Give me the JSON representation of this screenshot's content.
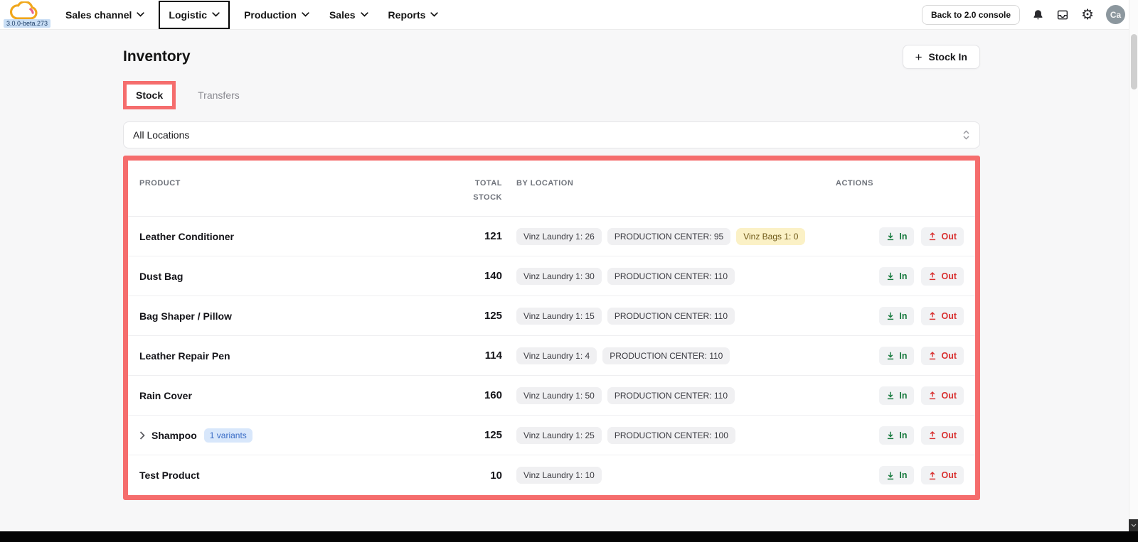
{
  "topbar": {
    "version_badge": "3.0.0-beta.273",
    "nav_items": [
      {
        "label": "Sales channel",
        "boxed": false
      },
      {
        "label": "Logistic",
        "boxed": true
      },
      {
        "label": "Production",
        "boxed": false
      },
      {
        "label": "Sales",
        "boxed": false
      },
      {
        "label": "Reports",
        "boxed": false
      }
    ],
    "back_button": "Back to 2.0 console",
    "avatar_initials": "Ca"
  },
  "page": {
    "title": "Inventory",
    "stock_in_button": "Stock In",
    "tabs": [
      {
        "label": "Stock",
        "active": true,
        "highlighted": true
      },
      {
        "label": "Transfers",
        "active": false,
        "highlighted": false
      }
    ],
    "location_filter": {
      "value": "All Locations"
    }
  },
  "inventory_table": {
    "headers": {
      "product": "PRODUCT",
      "total_stock": "TOTAL STOCK",
      "by_location": "BY LOCATION",
      "actions": "ACTIONS"
    },
    "action_in": "In",
    "action_out": "Out",
    "rows": [
      {
        "product": "Leather Conditioner",
        "total_stock": "121",
        "expandable": false,
        "variants_badge": "",
        "locations": [
          {
            "label": "Vinz Laundry 1: 26",
            "style": "gray"
          },
          {
            "label": "PRODUCTION CENTER: 95",
            "style": "gray"
          },
          {
            "label": "Vinz Bags 1: 0",
            "style": "yellow"
          }
        ]
      },
      {
        "product": "Dust Bag",
        "total_stock": "140",
        "expandable": false,
        "variants_badge": "",
        "locations": [
          {
            "label": "Vinz Laundry 1: 30",
            "style": "gray"
          },
          {
            "label": "PRODUCTION CENTER: 110",
            "style": "gray"
          }
        ]
      },
      {
        "product": "Bag Shaper / Pillow",
        "total_stock": "125",
        "expandable": false,
        "variants_badge": "",
        "locations": [
          {
            "label": "Vinz Laundry 1: 15",
            "style": "gray"
          },
          {
            "label": "PRODUCTION CENTER: 110",
            "style": "gray"
          }
        ]
      },
      {
        "product": "Leather Repair Pen",
        "total_stock": "114",
        "expandable": false,
        "variants_badge": "",
        "locations": [
          {
            "label": "Vinz Laundry 1: 4",
            "style": "gray"
          },
          {
            "label": "PRODUCTION CENTER: 110",
            "style": "gray"
          }
        ]
      },
      {
        "product": "Rain Cover",
        "total_stock": "160",
        "expandable": false,
        "variants_badge": "",
        "locations": [
          {
            "label": "Vinz Laundry 1: 50",
            "style": "gray"
          },
          {
            "label": "PRODUCTION CENTER: 110",
            "style": "gray"
          }
        ]
      },
      {
        "product": "Shampoo",
        "total_stock": "125",
        "expandable": true,
        "variants_badge": "1 variants",
        "locations": [
          {
            "label": "Vinz Laundry 1: 25",
            "style": "gray"
          },
          {
            "label": "PRODUCTION CENTER: 100",
            "style": "gray"
          }
        ]
      },
      {
        "product": "Test Product",
        "total_stock": "10",
        "expandable": false,
        "variants_badge": "",
        "locations": [
          {
            "label": "Vinz Laundry 1: 10",
            "style": "gray"
          }
        ]
      }
    ]
  },
  "colors": {
    "annotation_red": "#f56d6d",
    "in_green": "#187a3e",
    "out_red": "#d93030",
    "yellow_pill_bg": "#fbf1c6",
    "gray_pill_bg": "#f0f0f2",
    "variants_badge_bg": "#d8e7fb"
  }
}
